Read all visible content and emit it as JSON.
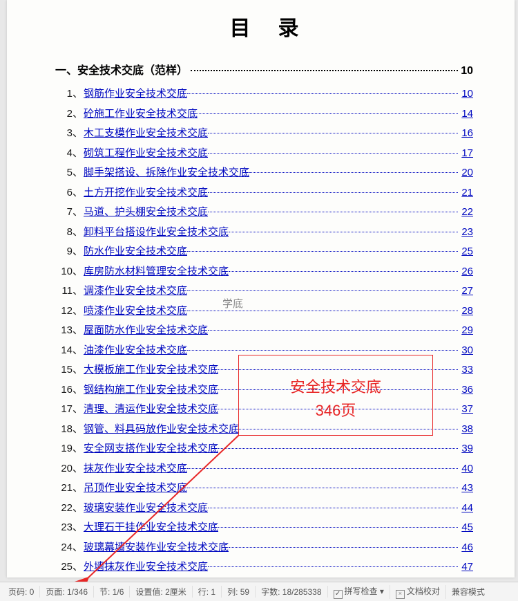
{
  "title": "目录",
  "sectionHeader": {
    "label": "一、安全技术交底（范样）",
    "page": "10"
  },
  "landMark": "学底",
  "redBox": {
    "line1": "安全技术交底",
    "line2": "346页"
  },
  "toc": [
    {
      "n": "1、",
      "t": "钢筋作业安全技术交底",
      "p": "10"
    },
    {
      "n": "2、",
      "t": "砼施工作业安全技术交底",
      "p": "14"
    },
    {
      "n": "3、",
      "t": "木工支模作业安全技术交底",
      "p": "16"
    },
    {
      "n": "4、",
      "t": "砌筑工程作业安全技术交底",
      "p": "17"
    },
    {
      "n": "5、",
      "t": "脚手架搭设、拆除作业安全技术交底",
      "p": "20"
    },
    {
      "n": "6、",
      "t": "土方开挖作业安全技术交底",
      "p": "21"
    },
    {
      "n": "7、",
      "t": "马道、护头棚安全技术交底",
      "p": "22"
    },
    {
      "n": "8、",
      "t": "卸料平台搭设作业安全技术交底",
      "p": "23"
    },
    {
      "n": "9、",
      "t": "防水作业安全技术交底",
      "p": "25"
    },
    {
      "n": "10、",
      "t": "库房防水材料管理安全技术交底",
      "p": "26"
    },
    {
      "n": "11、",
      "t": "调漆作业安全技术交底",
      "p": "27"
    },
    {
      "n": "12、",
      "t": "喷漆作业安全技术交底",
      "p": "28"
    },
    {
      "n": "13、",
      "t": "屋面防水作业安全技术交底",
      "p": "29"
    },
    {
      "n": "14、",
      "t": "油漆作业安全技术交底",
      "p": "30"
    },
    {
      "n": "15、",
      "t": "大模板施工作业安全技术交底",
      "p": "33"
    },
    {
      "n": "16、",
      "t": "钢结构施工作业安全技术交底",
      "p": "36"
    },
    {
      "n": "17、",
      "t": "清理、清运作业安全技术交底",
      "p": "37"
    },
    {
      "n": "18、",
      "t": "钢管、料具码放作业安全技术交底",
      "p": "38"
    },
    {
      "n": "19、",
      "t": "安全网支搭作业安全技术交底",
      "p": "39"
    },
    {
      "n": "20、",
      "t": "抹灰作业安全技术交底",
      "p": "40"
    },
    {
      "n": "21、",
      "t": "吊顶作业安全技术交底",
      "p": "43"
    },
    {
      "n": "22、",
      "t": "玻璃安装作业安全技术交底",
      "p": "44"
    },
    {
      "n": "23、",
      "t": "大理石干挂作业安全技术交底",
      "p": "45"
    },
    {
      "n": "24、",
      "t": "玻璃幕墙安装作业安全技术交底",
      "p": "46"
    },
    {
      "n": "25、",
      "t": "外墙抹灰作业安全技术交底",
      "p": "47"
    }
  ],
  "status": {
    "pageCode": "页码: 0",
    "page": "页面: 1/346",
    "section": "节: 1/6",
    "setVal": "设置值: 2厘米",
    "row": "行: 1",
    "col": "列: 59",
    "words": "字数: 18/285338",
    "spell": "拼写检查",
    "proof": "文档校对",
    "compat": "兼容模式"
  }
}
